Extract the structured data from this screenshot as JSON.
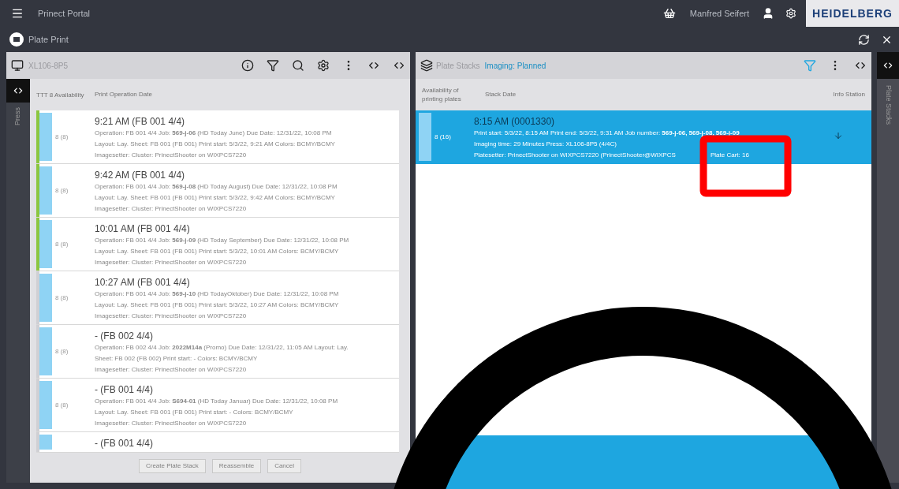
{
  "top_bar": {
    "title": "Prinect Portal",
    "user": "Manfred Seifert",
    "logo": "HEIDELBERG"
  },
  "app_bar": {
    "title": "Plate Print"
  },
  "left_panel": {
    "title": "XL106-8P5",
    "side_tab": "Press",
    "columns": [
      "TTT 8 Availability",
      "Print Operation Date"
    ],
    "rows": [
      {
        "marked": true,
        "availability": "8 (8)",
        "level": 1,
        "title": "9:21 AM (FB 001 4/4)",
        "lines": [
          "Operation: FB 001 4/4  Job: **569-j-06** (HD Today June)  Due Date: 12/31/22, 10:08 PM",
          "Layout: Lay. Sheet: FB 001 (FB 001)  Print start: 5/3/22, 9:21 AM  Colors: BCMY/BCMY",
          "Imagesetter: Cluster: PrinectShooter on WIXPCS7220"
        ]
      },
      {
        "marked": true,
        "availability": "8 (8)",
        "level": 1,
        "title": "9:42 AM (FB 001 4/4)",
        "lines": [
          "Operation: FB 001 4/4  Job: **569-j-08** (HD Today August)  Due Date: 12/31/22, 10:08 PM",
          "Layout: Lay. Sheet: FB 001 (FB 001)  Print start: 5/3/22, 9:42 AM  Colors: BCMY/BCMY",
          "Imagesetter: Cluster: PrinectShooter on WIXPCS7220"
        ]
      },
      {
        "marked": true,
        "availability": "8 (8)",
        "level": 1,
        "title": "10:01 AM (FB 001 4/4)",
        "lines": [
          "Operation: FB 001 4/4  Job: **569-j-09** (HD Today September)  Due Date: 12/31/22, 10:08 PM",
          "Layout: Lay. Sheet: FB 001 (FB 001)  Print start: 5/3/22, 10:01 AM  Colors: BCMY/BCMY",
          "Imagesetter: Cluster: PrinectShooter on WIXPCS7220"
        ]
      },
      {
        "marked": false,
        "availability": "8 (8)",
        "level": 1,
        "title": "10:27 AM (FB 001 4/4)",
        "lines": [
          "Operation: FB 001 4/4  Job: **569-j-10** (HD TodayOktober)  Due Date: 12/31/22, 10:08 PM",
          "Layout: Lay. Sheet: FB 001 (FB 001)  Print start: 5/3/22, 10:27 AM  Colors: BCMY/BCMY",
          "Imagesetter: Cluster: PrinectShooter on WIXPCS7220"
        ]
      },
      {
        "marked": false,
        "availability": "8 (8)",
        "level": 1,
        "title": "- (FB 002 4/4)",
        "lines": [
          "Operation: FB 002 4/4  Job: **2022M14a** (Promo)  Due Date: 12/31/22, 11:05 AM  Layout: Lay.",
          "Sheet: FB 002 (FB 002)  Print start: -  Colors: BCMY/BCMY",
          "Imagesetter: Cluster: PrinectShooter on WIXPCS7220"
        ]
      },
      {
        "marked": false,
        "availability": "8 (8)",
        "level": 1,
        "title": "- (FB 001 4/4)",
        "lines": [
          "Operation: FB 001 4/4  Job: **S694-01** (HD Today Januar)  Due Date: 12/31/22, 10:08 PM",
          "Layout: Lay. Sheet: FB 001 (FB 001)  Print start: -  Colors: BCMY/BCMY",
          "Imagesetter: Cluster: PrinectShooter on WIXPCS7220"
        ]
      },
      {
        "marked": false,
        "availability": "",
        "level": 1,
        "title": "- (FB 001 4/4)",
        "lines": []
      }
    ],
    "buttons": [
      {
        "label": "Create Plate Stack",
        "disabled": true
      },
      {
        "label": "Reassemble",
        "disabled": true
      },
      {
        "label": "Cancel",
        "disabled": true
      }
    ]
  },
  "right_panel": {
    "title": "Plate Stacks",
    "subtitle": "Imaging: Planned",
    "side_tab": "Plate Stacks",
    "columns": [
      "Availability of printing plates",
      "Stack Date",
      "Info Station"
    ],
    "rows": [
      {
        "selected": true,
        "availability": "8 (16)",
        "level": 1,
        "title": "8:15 AM (0001330)",
        "lines": [
          "Print start: 5/3/22, 8:15 AM  Print end: 5/3/22, 9:31 AM  Job number: **569-j-06, 569-j-08, 569-j-09**",
          "Imaging time: 29 Minutes  Press: XL106-8P5 (4/4C)",
          [
            "Platesetter: PrinectShooter on WIXPCS7220 (PrinectShooter@WIXPCS",
            "Plate Cart: 16"
          ]
        ]
      }
    ]
  }
}
